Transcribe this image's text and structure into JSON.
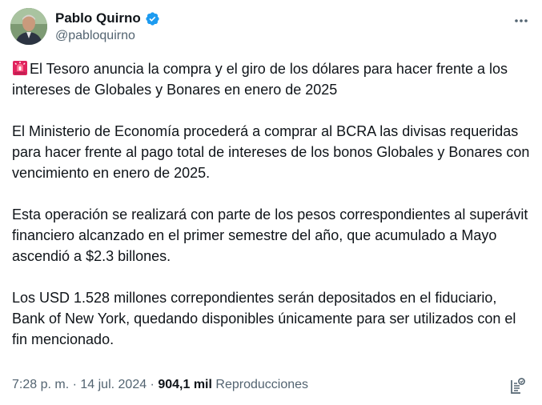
{
  "author": {
    "display_name": "Pablo Quirno",
    "handle": "@pabloquirno",
    "verified": true,
    "verified_color": "#1d9bf0"
  },
  "tweet": {
    "paragraphs": [
      "El Tesoro anuncia la compra y el giro de los dólares para hacer frente a los intereses de Globales y Bonares en enero de 2025",
      "El Ministerio de Economía procederá a comprar al BCRA las divisas requeridas para hacer frente al pago total de intereses de los bonos Globales y Bonares con vencimiento en enero de 2025.",
      "Esta operación se realizará con parte de los pesos correspondientes al superávit financiero alcanzado en el primer semestre del año, que acumulado a Mayo ascendió a $2.3 billones.",
      "Los USD 1.528 millones   correpondientes serán depositados en el fiduciario, Bank of New York, quedando disponibles únicamente para ser utilizados con el fin mencionado."
    ],
    "leading_emoji": "rotating-light-icon"
  },
  "meta": {
    "time": "7:28 p. m.",
    "separator": " · ",
    "date": "14 jul. 2024",
    "views_count": "904,1 mil",
    "views_label": "Reproducciones"
  },
  "colors": {
    "text": "#0f1419",
    "secondary": "#536471",
    "verified": "#1d9bf0",
    "siren": "#e0245e"
  }
}
